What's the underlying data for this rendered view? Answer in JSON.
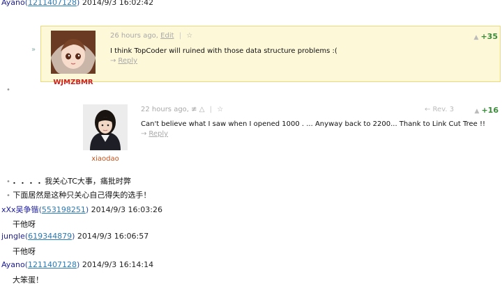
{
  "top_line": {
    "user": "Ayano",
    "uid": "1211407128",
    "timestamp": "2014/9/3 16:02:42"
  },
  "comments": [
    {
      "author": "WJMZBMR",
      "time": "26 hours ago,",
      "edit_label": "Edit",
      "pipe": "|",
      "star": "☆",
      "text": "I think TopCoder will ruined with those data structure problems :(",
      "reply_arrow": "→",
      "reply_label": "Reply",
      "vote": "+35",
      "vote_arrow": "▲",
      "expand_marker": "»"
    },
    {
      "author": "xiaodao",
      "time": "22 hours ago,",
      "history": "≢",
      "pipe1": "△",
      "pipe": "|",
      "star": "☆",
      "rev": "← Rev. 3",
      "text": "Can't believe what I saw when I opened 1000 . ... Anyway back to 2200... Thank to Link Cut Tree !!",
      "reply_arrow": "→",
      "reply_label": "Reply",
      "vote": "+16",
      "vote_arrow": "▲"
    }
  ],
  "standalone_bullet": "•",
  "chat": [
    {
      "bullet": "•",
      "dots": ". . . .",
      "text": "我关心TC大事，痛批时弊"
    },
    {
      "bullet": "•",
      "text": "下面居然是这种只关心自己得失的选手！"
    }
  ],
  "chat_lines": [
    {
      "user": "xXx吴争锴",
      "uid": "553198251",
      "timestamp": "2014/9/3 16:03:26",
      "message": "干他呀"
    },
    {
      "user": "jungle",
      "uid": "619344879",
      "timestamp": "2014/9/3 16:06:57",
      "message": "干他呀"
    },
    {
      "user": "Ayano",
      "uid": "1211407128",
      "timestamp": "2014/9/3 16:14:14",
      "message": "大笨蛋！"
    }
  ]
}
